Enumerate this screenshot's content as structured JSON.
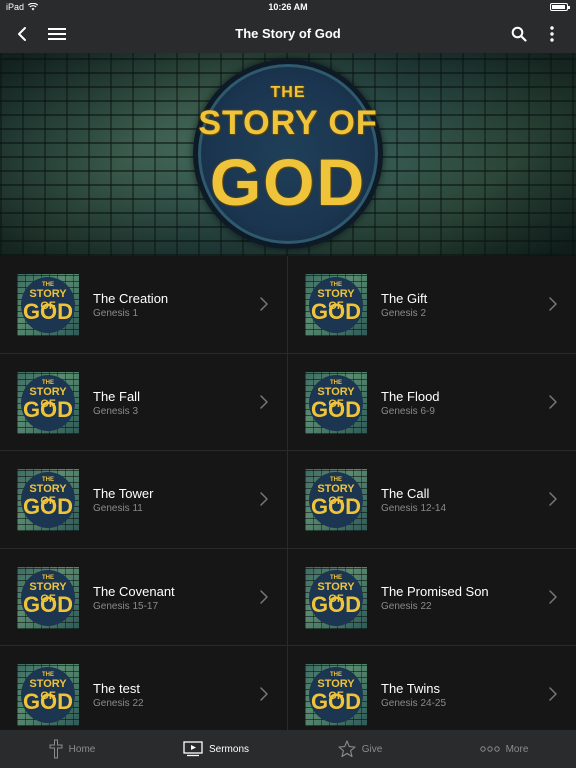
{
  "status_bar": {
    "device": "iPad",
    "time": "10:26 AM"
  },
  "nav": {
    "title": "The Story of God"
  },
  "hero": {
    "logo_line1": "THE",
    "logo_line2": "STORY OF",
    "logo_line3": "GOD"
  },
  "thumb_text": {
    "l1": "THE",
    "l2": "STORY OF",
    "l3": "GOD"
  },
  "sermons": [
    {
      "title": "The Creation",
      "passage": "Genesis 1"
    },
    {
      "title": "The Gift",
      "passage": "Genesis 2"
    },
    {
      "title": "The Fall",
      "passage": "Genesis 3"
    },
    {
      "title": "The Flood",
      "passage": "Genesis 6-9"
    },
    {
      "title": "The Tower",
      "passage": "Genesis 11"
    },
    {
      "title": "The Call",
      "passage": "Genesis 12-14"
    },
    {
      "title": "The Covenant",
      "passage": "Genesis 15-17"
    },
    {
      "title": "The Promised Son",
      "passage": "Genesis 22"
    },
    {
      "title": "The test",
      "passage": "Genesis 22"
    },
    {
      "title": "The Twins",
      "passage": "Genesis 24-25"
    }
  ],
  "tabs": [
    {
      "label": "Home",
      "icon": "cross-icon"
    },
    {
      "label": "Sermons",
      "icon": "video-icon"
    },
    {
      "label": "Give",
      "icon": "star-icon"
    },
    {
      "label": "More",
      "icon": "more-dots-icon"
    }
  ],
  "colors": {
    "bar": "#2a2b2d",
    "background": "#161616",
    "accent_gold": "#f0c43a",
    "subtitle": "#8a8a8a"
  }
}
